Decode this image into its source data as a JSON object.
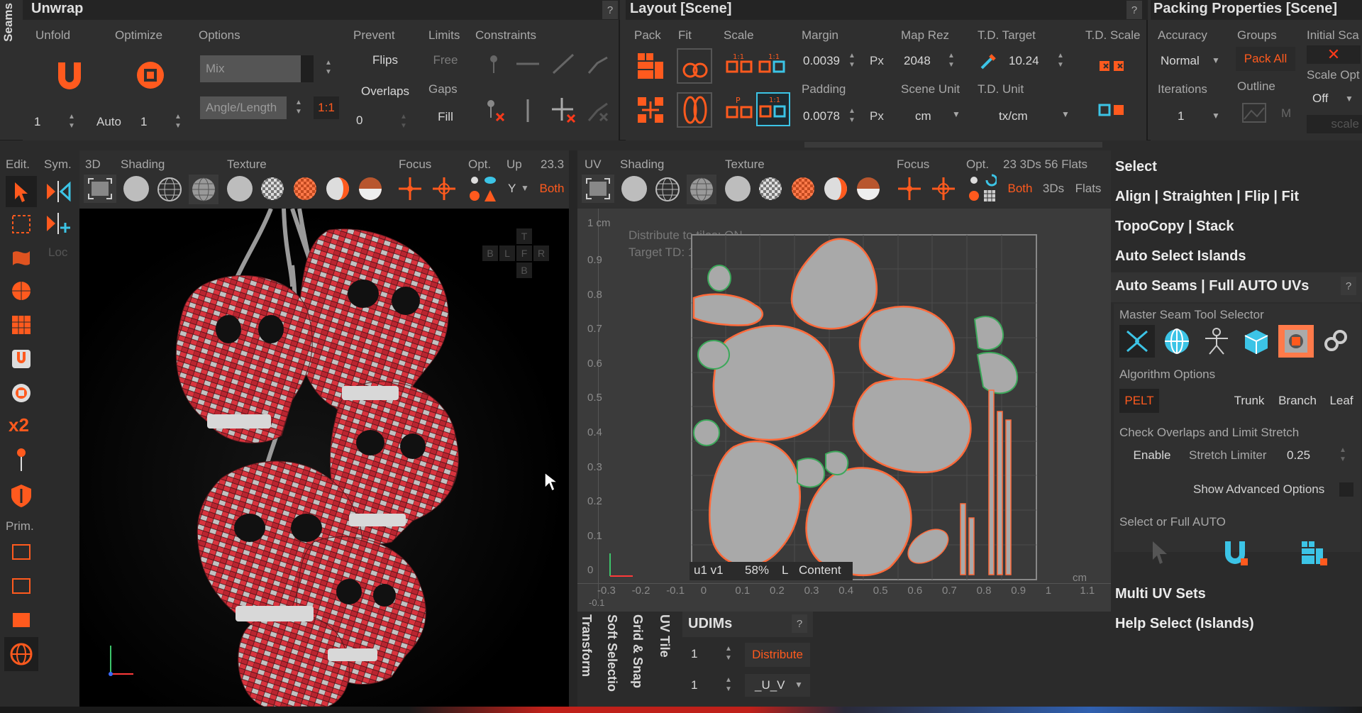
{
  "colors": {
    "accent": "#ff5a1e",
    "bg": "#2b2b2b",
    "panel": "#2f2f2f",
    "field": "#1f1f1f",
    "cyan": "#3cc4e6"
  },
  "seams_tab": "Seams",
  "unwrap": {
    "title": "Unwrap",
    "help": "?",
    "unfold": "Unfold",
    "optimize": "Optimize",
    "options": "Options",
    "prevent": "Prevent",
    "limits": "Limits",
    "constraints": "Constraints",
    "mode_value": "Mix",
    "metric_value": "Angle/Length",
    "ratio": "1:1",
    "flips": "Flips",
    "overlaps": "Overlaps",
    "free": "Free",
    "gaps": "Gaps",
    "fill": "Fill",
    "iter_value": "1",
    "auto_label": "Auto",
    "auto_value": "1",
    "overlaps_value": "0"
  },
  "layout": {
    "title": "Layout [Scene]",
    "help": "?",
    "pack": "Pack",
    "fit": "Fit",
    "scale": "Scale",
    "margin": "Margin",
    "margin_value": "0.0039",
    "margin_unit": "Px",
    "padding": "Padding",
    "padding_value": "0.0078",
    "padding_unit": "Px",
    "map_rez": "Map Rez",
    "map_rez_value": "2048",
    "scene_unit": "Scene Unit",
    "scene_unit_value": "cm",
    "td_target": "T.D. Target",
    "td_target_value": "10.24",
    "td_unit": "T.D. Unit",
    "td_unit_value": "tx/cm",
    "td_scale": "T.D. Scale"
  },
  "packing": {
    "title": "Packing Properties [Scene]",
    "accuracy": "Accuracy",
    "accuracy_value": "Normal",
    "groups": "Groups",
    "pack_all": "Pack All",
    "initial_scale": "Initial Sca",
    "iterations": "Iterations",
    "iterations_value": "1",
    "outline": "Outline",
    "outline_m": "M",
    "scale_opt": "Scale Opt",
    "scale_opt_value": "Off",
    "scale_btn": "scale"
  },
  "viewport3d": {
    "edit": "Edit.",
    "sym": "Sym.",
    "label": "3D",
    "shading": "Shading",
    "texture": "Texture",
    "focus": "Focus",
    "opt": "Opt.",
    "up": "Up",
    "up_value": "Y",
    "count": "23.3",
    "both": "Both",
    "loc": "Loc",
    "prim": "Prim.",
    "gizmo": {
      "t": "T",
      "b": "B",
      "l": "L",
      "f": "F",
      "r": "R",
      "bottom": "B"
    }
  },
  "viewport_uv": {
    "label": "UV",
    "shading": "Shading",
    "texture": "Texture",
    "focus": "Focus",
    "opt": "Opt.",
    "stats": "23 3Ds 56 Flats",
    "both": "Both",
    "threeds": "3Ds",
    "flats": "Flats",
    "overlay_line1": "Distribute to tiles: ON",
    "overlay_line2": "Target TD: 10.24 tx/cm",
    "y_unit": "1 cm",
    "x_unit": "cm",
    "y_ticks": [
      "0.9",
      "0.8",
      "0.7",
      "0.6",
      "0.5",
      "0.4",
      "0.3",
      "0.2",
      "0.1",
      "0"
    ],
    "x_ticks": [
      "-0.3",
      "-0.2",
      "-0.1",
      "0",
      "0.1",
      "0.2",
      "0.3",
      "0.4",
      "0.5",
      "0.6",
      "0.7",
      "0.8",
      "0.9",
      "1",
      "1.1"
    ],
    "x_extra": "-0.1",
    "status": {
      "tile": "u1 v1",
      "zoom": "58%",
      "l": "L",
      "content": "Content"
    }
  },
  "bottom_tabs": [
    "Transform",
    "Soft Selectio",
    "Grid & Snap",
    "UV Tile"
  ],
  "udims": {
    "title": "UDIMs",
    "help": "?",
    "value1": "1",
    "value2": "1",
    "distribute": "Distribute",
    "uv_value": "_U_V"
  },
  "right_panel": {
    "select": "Select",
    "align": "Align | Straighten | Flip | Fit",
    "topocopy": "TopoCopy | Stack",
    "auto_select": "Auto Select Islands",
    "auto_seams": "Auto Seams | Full AUTO UVs",
    "help": "?",
    "master_seam": "Master Seam Tool Selector",
    "algorithm": "Algorithm Options",
    "pelt": "PELT",
    "trunk": "Trunk",
    "branch": "Branch",
    "leaf": "Leaf",
    "check_overlaps": "Check Overlaps and Limit Stretch",
    "enable": "Enable",
    "stretch_limiter": "Stretch Limiter",
    "stretch_value": "0.25",
    "show_advanced": "Show Advanced Options",
    "select_full_auto": "Select or Full AUTO",
    "multi_uv": "Multi UV Sets",
    "help_select": "Help Select (Islands)"
  },
  "left_tools": {
    "x2": "x2"
  }
}
